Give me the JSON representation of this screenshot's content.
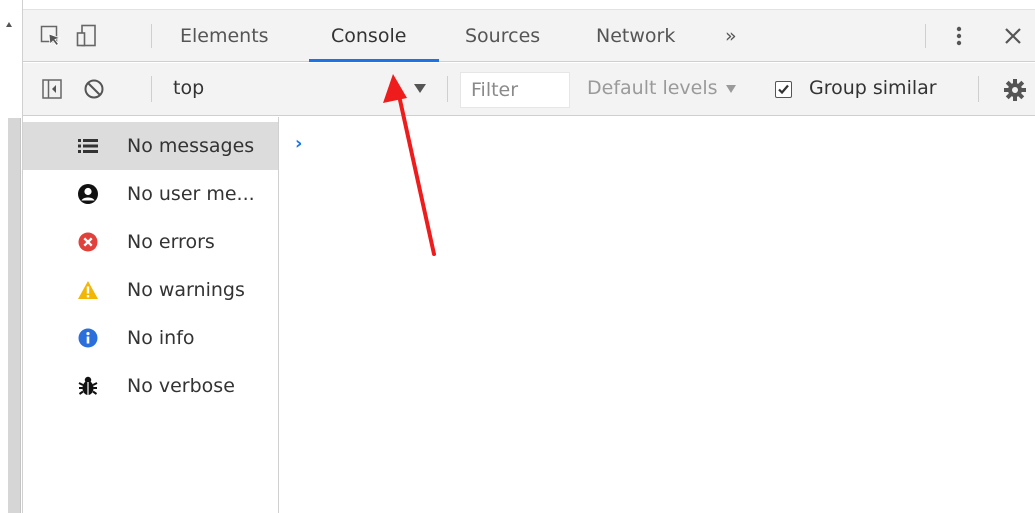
{
  "tabs": [
    {
      "label": "Elements"
    },
    {
      "label": "Console"
    },
    {
      "label": "Sources"
    },
    {
      "label": "Network"
    }
  ],
  "active_tab": "Console",
  "more_tabs_glyph": "»",
  "toolbar": {
    "context": "top",
    "filter_placeholder": "Filter",
    "levels_label": "Default levels",
    "group_similar_label": "Group similar",
    "group_similar_checked": true
  },
  "sidebar": {
    "items": [
      {
        "label": "No messages",
        "icon": "list-icon",
        "selected": true
      },
      {
        "label": "No user me...",
        "icon": "user-icon",
        "selected": false
      },
      {
        "label": "No errors",
        "icon": "error-icon",
        "selected": false
      },
      {
        "label": "No warnings",
        "icon": "warning-icon",
        "selected": false
      },
      {
        "label": "No info",
        "icon": "info-icon",
        "selected": false
      },
      {
        "label": "No verbose",
        "icon": "bug-icon",
        "selected": false
      }
    ]
  },
  "console": {
    "prompt_glyph": "›"
  },
  "colors": {
    "accent": "#1a73e8",
    "error": "#e0413a",
    "warning": "#f2b705",
    "info": "#2a6fdb",
    "annotation": "#ee1c1c"
  }
}
